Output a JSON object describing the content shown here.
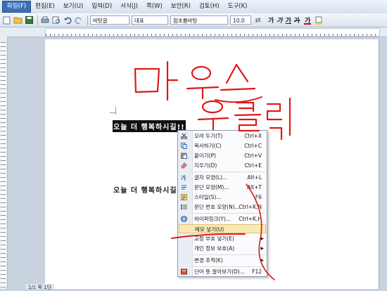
{
  "menubar": {
    "items": [
      "파일(F)",
      "편집(E)",
      "보기(U)",
      "입력(D)",
      "서식(J)",
      "쪽(W)",
      "보안(R)",
      "검토(H)",
      "도구(K)"
    ]
  },
  "toolbar": {
    "style_combo": "바탕글",
    "para_combo": "대표",
    "font_combo": "함초롬바탕",
    "size_combo": "10.0",
    "size_unit": "pt",
    "bold": "가",
    "italic": "가",
    "underline": "가",
    "strike": "가"
  },
  "document": {
    "line1": "오늘 더 행복하시길!!",
    "line2": "오늘 더 행복하시길!!"
  },
  "context_menu": {
    "items": [
      {
        "label": "오려 두기(T)",
        "shortcut": "Ctrl+X",
        "icon": "scissors-icon"
      },
      {
        "label": "복사하기(C)",
        "shortcut": "Ctrl+C",
        "icon": "copy-icon"
      },
      {
        "label": "붙이기(P)",
        "shortcut": "Ctrl+V",
        "icon": "paste-icon"
      },
      {
        "label": "지우기(D)",
        "shortcut": "Ctrl+E",
        "icon": "eraser-icon"
      },
      {
        "label": "글자 모양(L)...",
        "shortcut": "Alt+L",
        "icon": "char-shape-icon"
      },
      {
        "label": "문단 모양(M)...",
        "shortcut": "Alt+T",
        "icon": "para-shape-icon"
      },
      {
        "label": "스타일(S)...",
        "shortcut": "F6",
        "icon": "style-icon"
      },
      {
        "label": "문단 번호 모양(N)...",
        "shortcut": "Ctrl+K,N",
        "icon": "numbering-icon"
      },
      {
        "label": "하이퍼링크(Y)...",
        "shortcut": "Ctrl+K,H",
        "icon": "hyperlink-icon"
      },
      {
        "label": "메모 넣기(U)",
        "shortcut": "",
        "icon": ""
      },
      {
        "label": "교정 부호 넣기(E)",
        "shortcut": "",
        "icon": ""
      },
      {
        "label": "개인 정보 보호(A)",
        "shortcut": "",
        "icon": ""
      },
      {
        "label": "변경 추적(K)",
        "shortcut": "",
        "icon": ""
      },
      {
        "label": "단어 뜻 알아보기(D)...",
        "shortcut": "F12",
        "icon": "dictionary-icon"
      }
    ]
  },
  "annotation": {
    "line1": "마우스",
    "line2": "우클릭",
    "color": "#e01818"
  },
  "statusbar": {
    "text": "1/1 쪽 1단"
  },
  "colors": {
    "selection_bg": "#111111",
    "menu_highlight": "#f8e8b4",
    "workspace_bg": "#c9d3df"
  }
}
